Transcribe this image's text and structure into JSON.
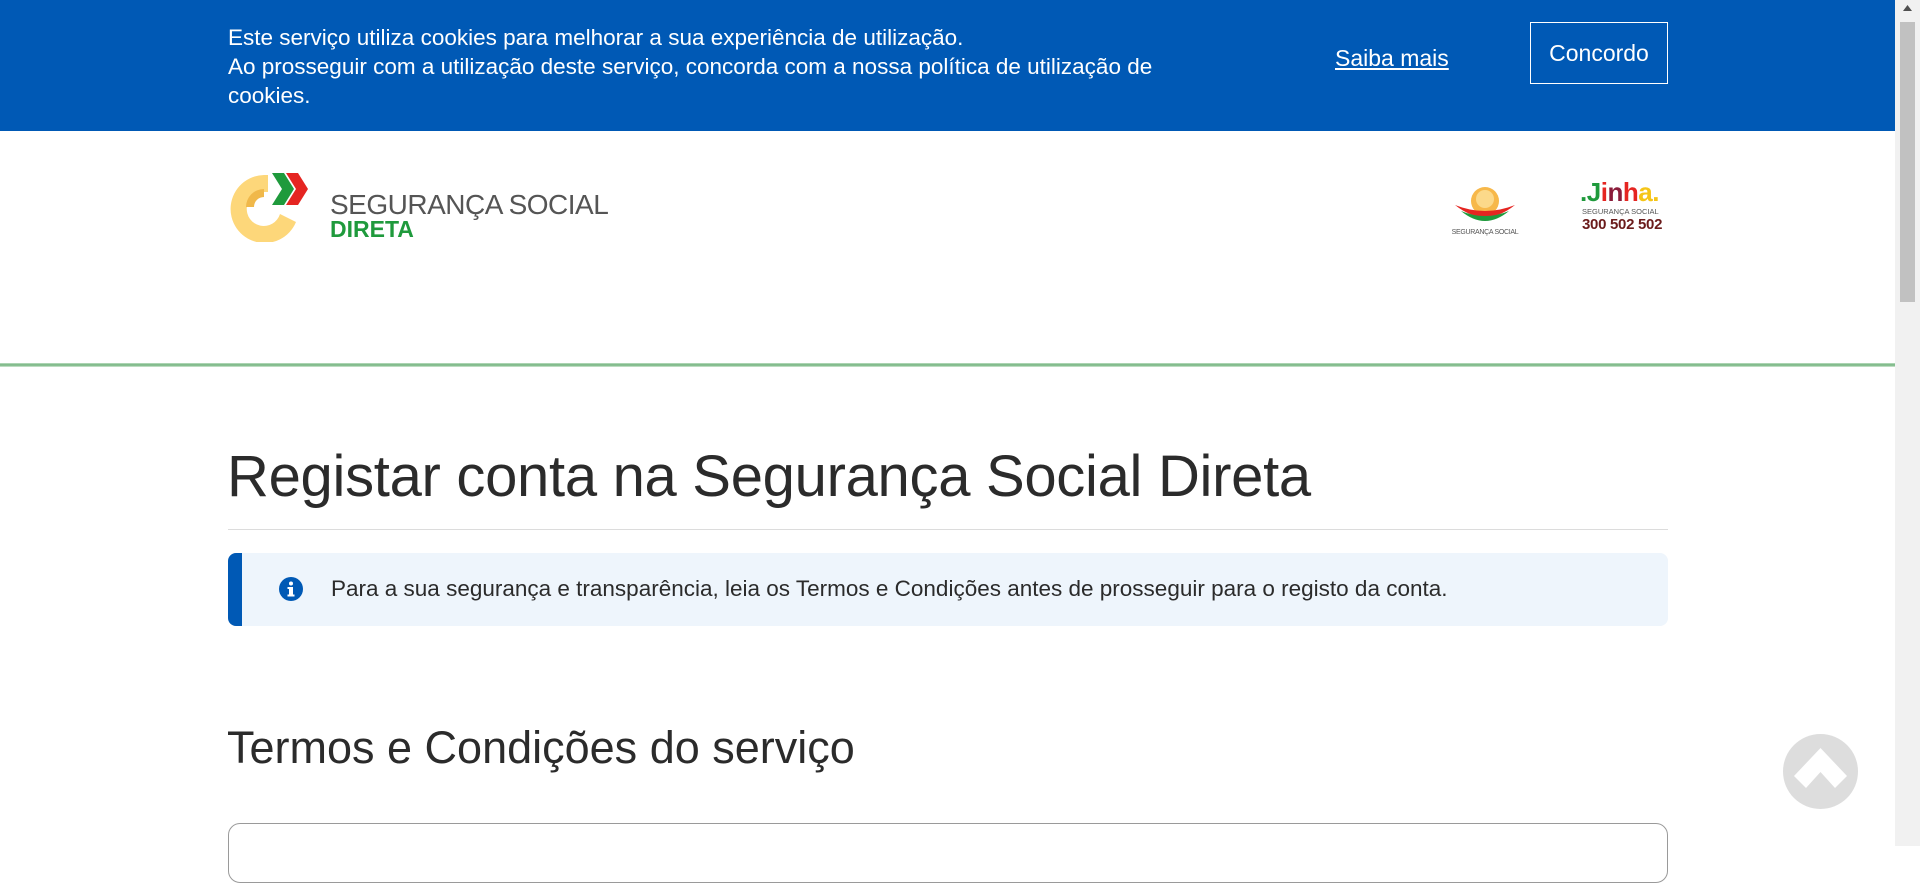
{
  "cookie_bar": {
    "line1": "Este serviço utiliza cookies para melhorar a sua experiência de utilização.",
    "line2": "Ao prosseguir com a utilização deste serviço, concorda com a nossa política de utilização de",
    "line3": "cookies.",
    "learn_more_label": "Saiba mais",
    "accept_label": "Concordo",
    "background_color": "#0059b5"
  },
  "header": {
    "logo": {
      "line1": "SEGURANÇA SOCIAL",
      "line2": "DIRETA"
    },
    "ss_logo_caption": "SEGURANÇA SOCIAL",
    "linha": {
      "word": ".Jinha.",
      "caption": "SEGURANÇA SOCIAL",
      "phone": "300 502 502"
    }
  },
  "main": {
    "page_title": "Registar conta na Segurança Social Direta",
    "info_message": "Para a sua segurança e transparência, leia os Termos e Condições antes de prosseguir para o registo da conta.",
    "info_icon": "info-circle-icon",
    "section_title": "Termos e Condições do serviço"
  },
  "back_to_top_icon": "chevron-up-icon",
  "colors": {
    "primary_blue": "#0059b5",
    "brand_green": "#1f9a3c",
    "info_bg": "#eef5fc"
  }
}
